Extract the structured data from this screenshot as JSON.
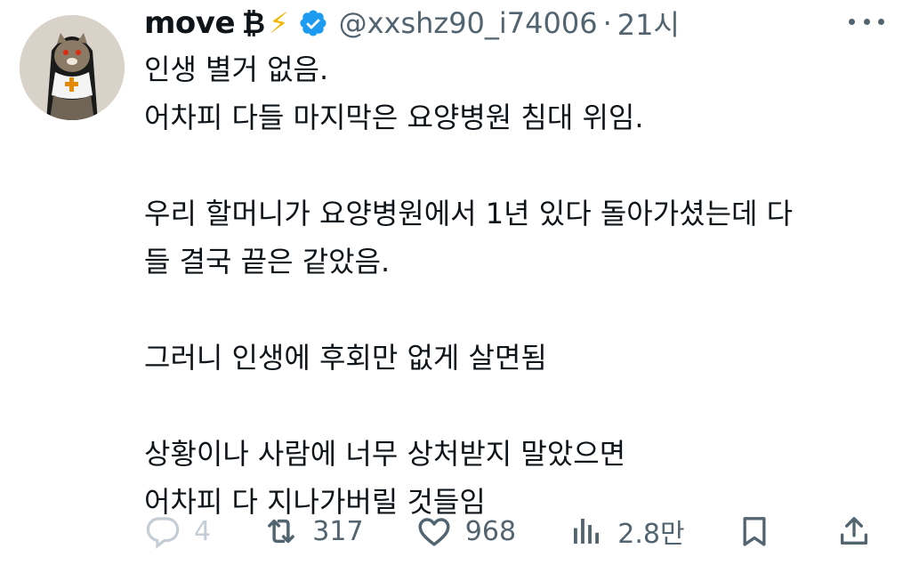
{
  "tweet": {
    "author": {
      "display_name": "move",
      "emoji_badges": "₿⚡",
      "verified": true,
      "handle": "@xxshz90_i74006",
      "separator": "·",
      "time": "21시"
    },
    "text": "인생 별거 없음.\n어차피 다들 마지막은 요양병원 침대 위임.\n\n우리 할머니가 요양병원에서 1년 있다 돌아가셨는데 다\n들 결국 끝은 같았음.\n\n그러니 인생에 후회만 없게 살면됨\n\n상황이나 사람에 너무 상처받지 말았으면\n어차피 다 지나가버릴 것들임",
    "metrics": {
      "replies": "4",
      "retweets": "317",
      "likes": "968",
      "views": "2.8만"
    }
  },
  "icons": {
    "more": "more-horizontal-icon",
    "reply": "reply-icon",
    "retweet": "retweet-icon",
    "like": "heart-icon",
    "views": "views-chart-icon",
    "bookmark": "bookmark-icon",
    "share": "share-icon"
  },
  "colors": {
    "text": "#0f1419",
    "secondary": "#536471",
    "verified": "#1d9bf0",
    "bolt": "#f5b400"
  }
}
